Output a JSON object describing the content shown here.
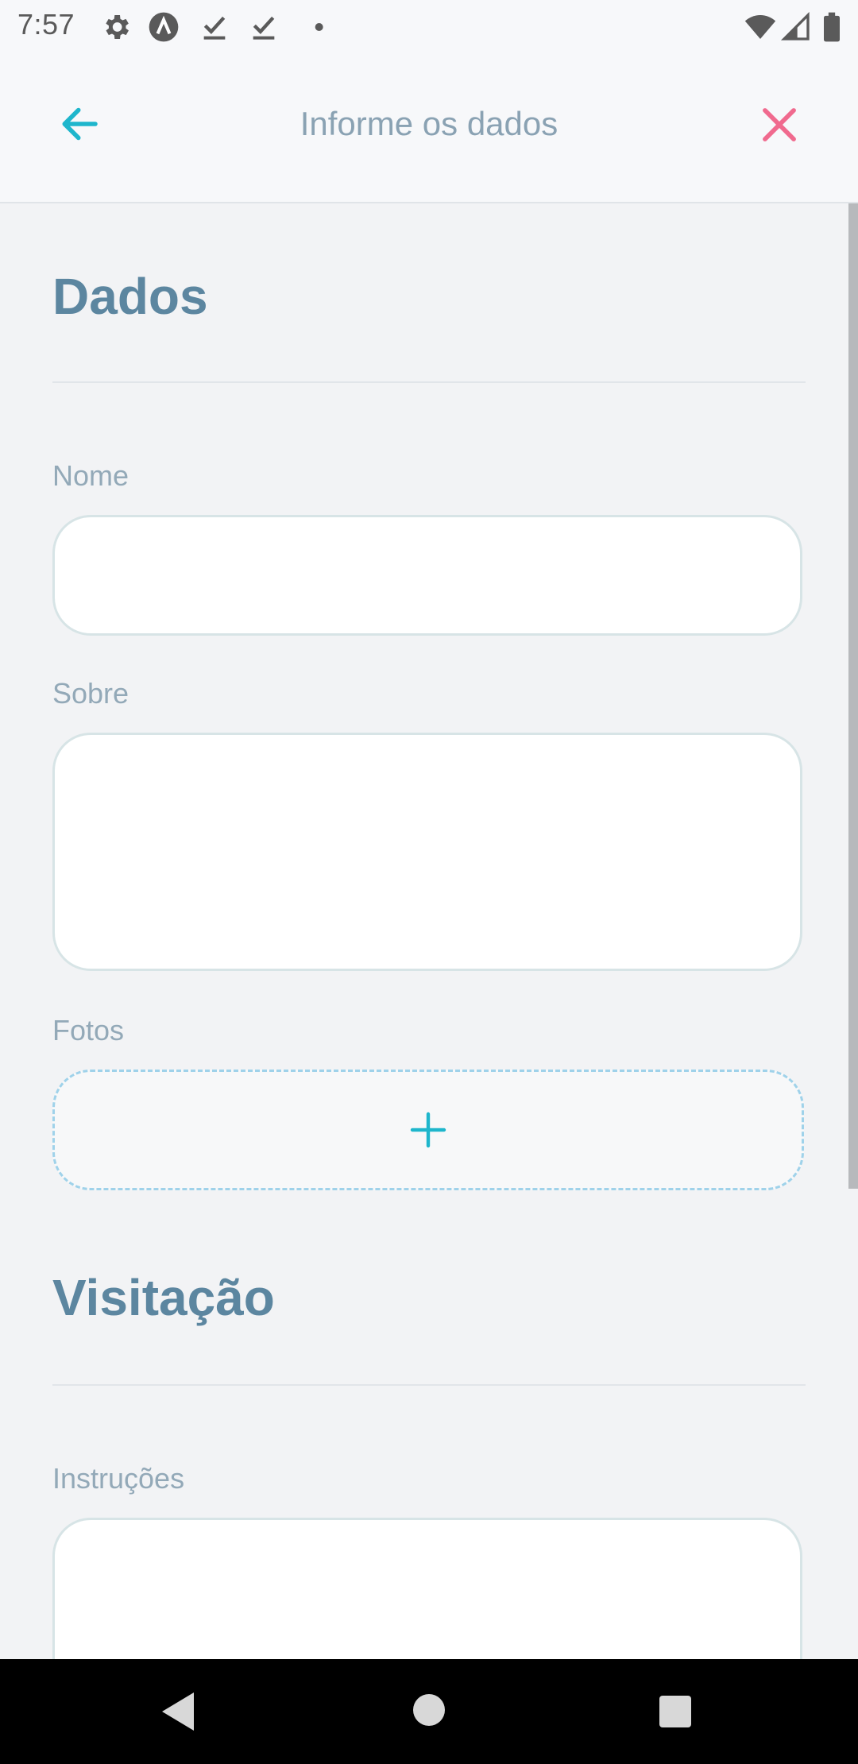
{
  "status_bar": {
    "time": "7:57",
    "left_icons": [
      "gear-icon",
      "android-a-icon",
      "download-done-icon",
      "download-done-icon",
      "dot-icon"
    ],
    "right_icons": [
      "wifi-icon",
      "cell-signal-icon",
      "battery-icon"
    ]
  },
  "header": {
    "title": "Informe os dados",
    "back_icon": "arrow-left-icon",
    "close_icon": "close-icon",
    "back_color": "#1eb6cc",
    "close_color": "#f06a8e"
  },
  "sections": {
    "dados": {
      "title": "Dados",
      "fields": {
        "nome": {
          "label": "Nome",
          "value": ""
        },
        "sobre": {
          "label": "Sobre",
          "value": ""
        },
        "fotos": {
          "label": "Fotos",
          "add_icon": "plus-icon"
        }
      }
    },
    "visitacao": {
      "title": "Visitação",
      "fields": {
        "instrucoes": {
          "label": "Instruções",
          "value": ""
        }
      }
    }
  },
  "nav_bar": {
    "items": [
      "back-triangle-icon",
      "home-circle-icon",
      "recents-square-icon"
    ]
  },
  "colors": {
    "accent": "#1eb6cc",
    "section_title": "#5c86a0",
    "label": "#93a9b8",
    "close": "#f06a8e"
  }
}
